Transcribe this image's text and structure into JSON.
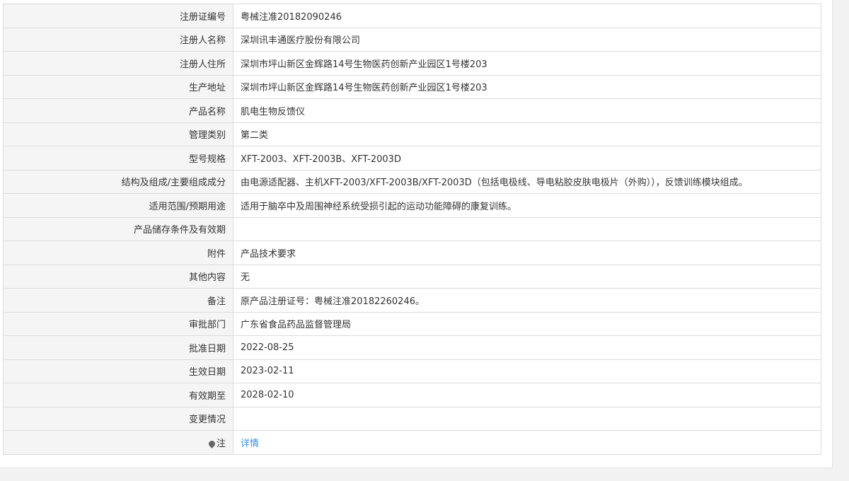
{
  "rows": [
    {
      "label": "注册证编号",
      "value": "粤械注准20182090246"
    },
    {
      "label": "注册人名称",
      "value": "深圳讯丰通医疗股份有限公司"
    },
    {
      "label": "注册人住所",
      "value": "深圳市坪山新区金辉路14号生物医药创新产业园区1号楼203"
    },
    {
      "label": "生产地址",
      "value": "深圳市坪山新区金辉路14号生物医药创新产业园区1号楼203"
    },
    {
      "label": "产品名称",
      "value": "肌电生物反馈仪"
    },
    {
      "label": "管理类别",
      "value": "第二类"
    },
    {
      "label": "型号规格",
      "value": "XFT-2003、XFT-2003B、XFT-2003D"
    },
    {
      "label": "结构及组成/主要组成成分",
      "value": "由电源适配器、主机XFT-2003/XFT-2003B/XFT-2003D（包括电极线、导电粘胶皮肤电极片（外购）），反馈训练模块组成。"
    },
    {
      "label": "适用范围/预期用途",
      "value": "适用于脑卒中及周围神经系统受损引起的运动功能障碍的康复训练。"
    },
    {
      "label": "产品储存条件及有效期",
      "value": ""
    },
    {
      "label": "附件",
      "value": "产品技术要求"
    },
    {
      "label": "其他内容",
      "value": "无"
    },
    {
      "label": "备注",
      "value": "原产品注册证号：粤械注准20182260246。"
    },
    {
      "label": "审批部门",
      "value": "广东省食品药品监督管理局"
    },
    {
      "label": "批准日期",
      "value": "2022-08-25"
    },
    {
      "label": "生效日期",
      "value": "2023-02-11"
    },
    {
      "label": "有效期至",
      "value": "2028-02-10"
    },
    {
      "label": "变更情况",
      "value": ""
    }
  ],
  "note_row": {
    "label": "注",
    "icon": "pin-icon",
    "link_text": "详情"
  },
  "colors": {
    "link": "#3a8ee6",
    "label_bg": "#f5f5f5",
    "border": "#dcdcdc"
  }
}
